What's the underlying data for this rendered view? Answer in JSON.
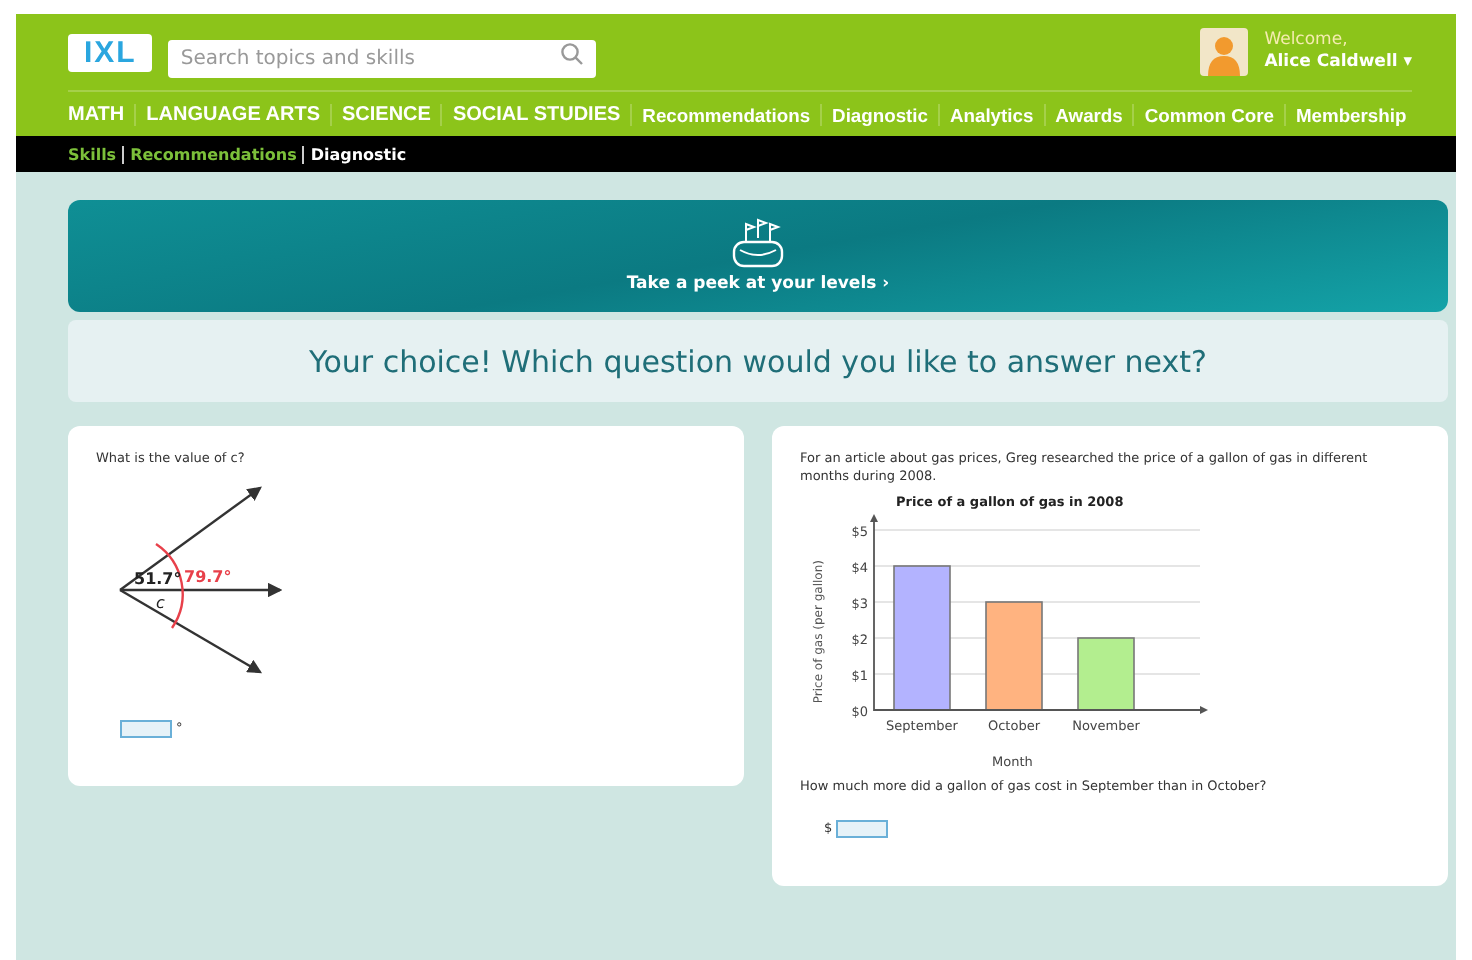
{
  "header": {
    "logo": "IXL",
    "search": {
      "placeholder": "Search topics and skills"
    },
    "user": {
      "greeting": "Welcome,",
      "name": "Alice Caldwell ▾"
    }
  },
  "nav": [
    {
      "label": "MATH",
      "kind": "subject"
    },
    {
      "label": "LANGUAGE ARTS",
      "kind": "subject"
    },
    {
      "label": "SCIENCE",
      "kind": "subject"
    },
    {
      "label": "SOCIAL STUDIES",
      "kind": "subject"
    },
    {
      "label": "Recommendations",
      "kind": "page"
    },
    {
      "label": "Diagnostic",
      "kind": "page"
    },
    {
      "label": "Analytics",
      "kind": "page"
    },
    {
      "label": "Awards",
      "kind": "page"
    },
    {
      "label": "Common Core",
      "kind": "page"
    },
    {
      "label": "Membership",
      "kind": "page"
    }
  ],
  "breadcrumb": [
    {
      "label": "Skills",
      "selected": false
    },
    {
      "label": "Recommendations",
      "selected": false
    },
    {
      "label": "Diagnostic",
      "selected": true
    }
  ],
  "banner": {
    "link": "Take a peek at your levels ›"
  },
  "prompt": "Your choice! Which question would you like to answer next?",
  "questions": [
    {
      "kind": "angle",
      "question": "What is the value of c?",
      "labels": {
        "inner": "51.7°",
        "outer": "79.7°",
        "unknown": "c"
      },
      "unit": "°"
    },
    {
      "kind": "chart",
      "intro": "For an article about gas prices, Greg researched the price of a gallon of gas in different months during 2008.",
      "chart_data": {
        "type": "bar",
        "title": "Price of a gallon of gas in 2008",
        "xlabel": "Month",
        "ylabel": "Price of gas (per gallon)",
        "categories": [
          "September",
          "October",
          "November"
        ],
        "values": [
          4,
          3,
          2
        ],
        "grid": true,
        "colors": [
          "#b3b3ff",
          "#ffb380",
          "#b3ee8f"
        ],
        "ylim": [
          0,
          5
        ],
        "yticks": [
          {
            "value": 0,
            "label": "$0"
          },
          {
            "value": 1,
            "label": "$1"
          },
          {
            "value": 2,
            "label": "$2"
          },
          {
            "value": 3,
            "label": "$3"
          },
          {
            "value": 4,
            "label": "$4"
          },
          {
            "value": 5,
            "label": "$5"
          }
        ]
      },
      "question": "How much more did a gallon of gas cost in September than in October?",
      "prefix": "$"
    }
  ]
}
